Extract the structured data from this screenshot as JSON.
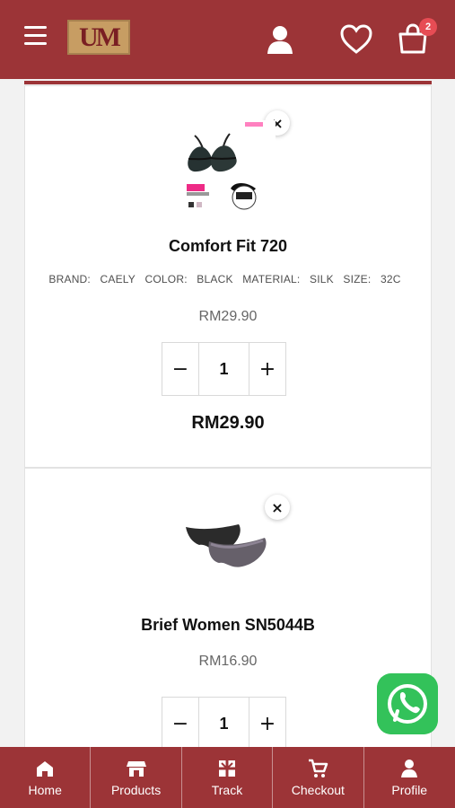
{
  "header": {
    "logo_text": "UM",
    "cart_count": "2",
    "icons": [
      "menu-icon",
      "user-icon",
      "heart-icon",
      "shopping-bag-icon"
    ]
  },
  "cart": {
    "items": [
      {
        "name": "Comfort Fit 720",
        "remove_label": "×",
        "image_icon": "bra-product-image",
        "attributes": [
          {
            "label": "BRAND:",
            "value": "CAELY"
          },
          {
            "label": "COLOR:",
            "value": "BLACK"
          },
          {
            "label": "MATERIAL:",
            "value": "SILK"
          },
          {
            "label": "SIZE:",
            "value": "32C"
          }
        ],
        "unit_price": "RM29.90",
        "quantity": "1",
        "minus_label": "−",
        "plus_label": "+",
        "total": "RM29.90"
      },
      {
        "name": "Brief Women SN5044B",
        "remove_label": "×",
        "image_icon": "brief-product-image",
        "unit_price": "RM16.90",
        "quantity": "1",
        "minus_label": "−",
        "plus_label": "+"
      }
    ]
  },
  "floating": {
    "whatsapp_icon": "whatsapp-icon"
  },
  "bottom_nav": [
    {
      "label": "Home",
      "icon": "home-icon"
    },
    {
      "label": "Products",
      "icon": "store-icon"
    },
    {
      "label": "Track",
      "icon": "package-icon"
    },
    {
      "label": "Checkout",
      "icon": "cart-icon"
    },
    {
      "label": "Profile",
      "icon": "profile-icon"
    }
  ],
  "colors": {
    "brand": "#9c3437",
    "badge": "#e74c54",
    "whatsapp": "#24b44a",
    "background": "#f2f2f2"
  }
}
